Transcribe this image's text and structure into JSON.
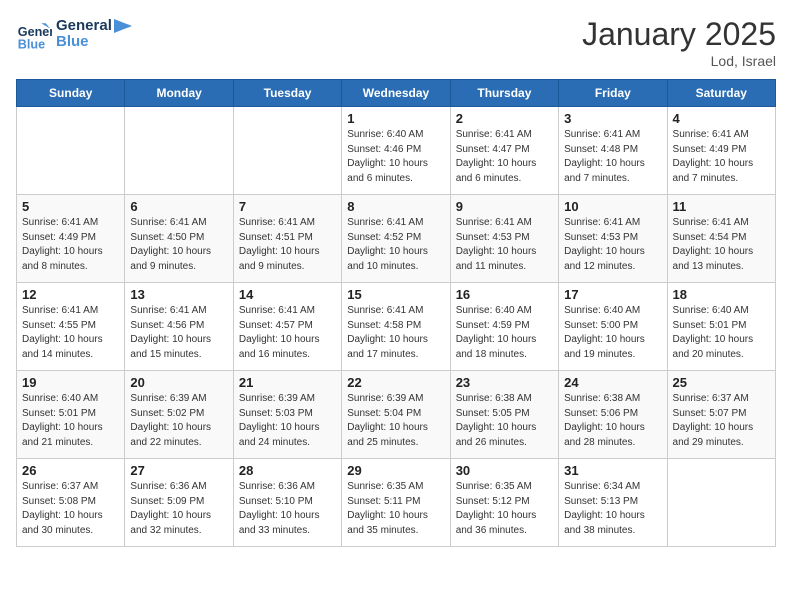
{
  "header": {
    "logo_line1": "General",
    "logo_line2": "Blue",
    "month": "January 2025",
    "location": "Lod, Israel"
  },
  "weekdays": [
    "Sunday",
    "Monday",
    "Tuesday",
    "Wednesday",
    "Thursday",
    "Friday",
    "Saturday"
  ],
  "weeks": [
    [
      {
        "day": "",
        "info": ""
      },
      {
        "day": "",
        "info": ""
      },
      {
        "day": "",
        "info": ""
      },
      {
        "day": "1",
        "info": "Sunrise: 6:40 AM\nSunset: 4:46 PM\nDaylight: 10 hours\nand 6 minutes."
      },
      {
        "day": "2",
        "info": "Sunrise: 6:41 AM\nSunset: 4:47 PM\nDaylight: 10 hours\nand 6 minutes."
      },
      {
        "day": "3",
        "info": "Sunrise: 6:41 AM\nSunset: 4:48 PM\nDaylight: 10 hours\nand 7 minutes."
      },
      {
        "day": "4",
        "info": "Sunrise: 6:41 AM\nSunset: 4:49 PM\nDaylight: 10 hours\nand 7 minutes."
      }
    ],
    [
      {
        "day": "5",
        "info": "Sunrise: 6:41 AM\nSunset: 4:49 PM\nDaylight: 10 hours\nand 8 minutes."
      },
      {
        "day": "6",
        "info": "Sunrise: 6:41 AM\nSunset: 4:50 PM\nDaylight: 10 hours\nand 9 minutes."
      },
      {
        "day": "7",
        "info": "Sunrise: 6:41 AM\nSunset: 4:51 PM\nDaylight: 10 hours\nand 9 minutes."
      },
      {
        "day": "8",
        "info": "Sunrise: 6:41 AM\nSunset: 4:52 PM\nDaylight: 10 hours\nand 10 minutes."
      },
      {
        "day": "9",
        "info": "Sunrise: 6:41 AM\nSunset: 4:53 PM\nDaylight: 10 hours\nand 11 minutes."
      },
      {
        "day": "10",
        "info": "Sunrise: 6:41 AM\nSunset: 4:53 PM\nDaylight: 10 hours\nand 12 minutes."
      },
      {
        "day": "11",
        "info": "Sunrise: 6:41 AM\nSunset: 4:54 PM\nDaylight: 10 hours\nand 13 minutes."
      }
    ],
    [
      {
        "day": "12",
        "info": "Sunrise: 6:41 AM\nSunset: 4:55 PM\nDaylight: 10 hours\nand 14 minutes."
      },
      {
        "day": "13",
        "info": "Sunrise: 6:41 AM\nSunset: 4:56 PM\nDaylight: 10 hours\nand 15 minutes."
      },
      {
        "day": "14",
        "info": "Sunrise: 6:41 AM\nSunset: 4:57 PM\nDaylight: 10 hours\nand 16 minutes."
      },
      {
        "day": "15",
        "info": "Sunrise: 6:41 AM\nSunset: 4:58 PM\nDaylight: 10 hours\nand 17 minutes."
      },
      {
        "day": "16",
        "info": "Sunrise: 6:40 AM\nSunset: 4:59 PM\nDaylight: 10 hours\nand 18 minutes."
      },
      {
        "day": "17",
        "info": "Sunrise: 6:40 AM\nSunset: 5:00 PM\nDaylight: 10 hours\nand 19 minutes."
      },
      {
        "day": "18",
        "info": "Sunrise: 6:40 AM\nSunset: 5:01 PM\nDaylight: 10 hours\nand 20 minutes."
      }
    ],
    [
      {
        "day": "19",
        "info": "Sunrise: 6:40 AM\nSunset: 5:01 PM\nDaylight: 10 hours\nand 21 minutes."
      },
      {
        "day": "20",
        "info": "Sunrise: 6:39 AM\nSunset: 5:02 PM\nDaylight: 10 hours\nand 22 minutes."
      },
      {
        "day": "21",
        "info": "Sunrise: 6:39 AM\nSunset: 5:03 PM\nDaylight: 10 hours\nand 24 minutes."
      },
      {
        "day": "22",
        "info": "Sunrise: 6:39 AM\nSunset: 5:04 PM\nDaylight: 10 hours\nand 25 minutes."
      },
      {
        "day": "23",
        "info": "Sunrise: 6:38 AM\nSunset: 5:05 PM\nDaylight: 10 hours\nand 26 minutes."
      },
      {
        "day": "24",
        "info": "Sunrise: 6:38 AM\nSunset: 5:06 PM\nDaylight: 10 hours\nand 28 minutes."
      },
      {
        "day": "25",
        "info": "Sunrise: 6:37 AM\nSunset: 5:07 PM\nDaylight: 10 hours\nand 29 minutes."
      }
    ],
    [
      {
        "day": "26",
        "info": "Sunrise: 6:37 AM\nSunset: 5:08 PM\nDaylight: 10 hours\nand 30 minutes."
      },
      {
        "day": "27",
        "info": "Sunrise: 6:36 AM\nSunset: 5:09 PM\nDaylight: 10 hours\nand 32 minutes."
      },
      {
        "day": "28",
        "info": "Sunrise: 6:36 AM\nSunset: 5:10 PM\nDaylight: 10 hours\nand 33 minutes."
      },
      {
        "day": "29",
        "info": "Sunrise: 6:35 AM\nSunset: 5:11 PM\nDaylight: 10 hours\nand 35 minutes."
      },
      {
        "day": "30",
        "info": "Sunrise: 6:35 AM\nSunset: 5:12 PM\nDaylight: 10 hours\nand 36 minutes."
      },
      {
        "day": "31",
        "info": "Sunrise: 6:34 AM\nSunset: 5:13 PM\nDaylight: 10 hours\nand 38 minutes."
      },
      {
        "day": "",
        "info": ""
      }
    ]
  ]
}
